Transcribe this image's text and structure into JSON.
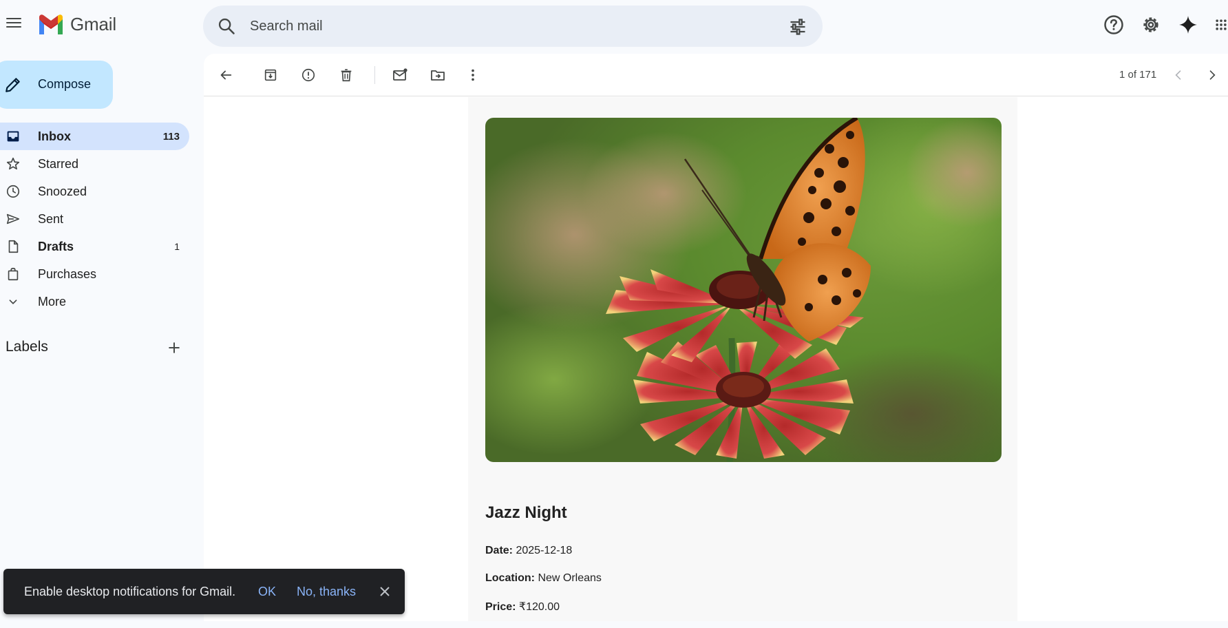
{
  "app": {
    "name": "Gmail"
  },
  "search": {
    "placeholder": "Search mail"
  },
  "sidebar": {
    "compose_label": "Compose",
    "items": [
      {
        "label": "Inbox",
        "count": "113",
        "icon": "inbox-icon",
        "active": true,
        "bold": true
      },
      {
        "label": "Starred",
        "count": "",
        "icon": "star-icon"
      },
      {
        "label": "Snoozed",
        "count": "",
        "icon": "clock-icon"
      },
      {
        "label": "Sent",
        "count": "",
        "icon": "send-icon"
      },
      {
        "label": "Drafts",
        "count": "1",
        "icon": "draft-icon",
        "bold": true
      },
      {
        "label": "Purchases",
        "count": "",
        "icon": "shopping-bag-icon"
      },
      {
        "label": "More",
        "count": "",
        "icon": "chevron-down-icon"
      }
    ],
    "labels_title": "Labels"
  },
  "toolbar": {
    "pager": "1 of 171",
    "icons": [
      "back-arrow-icon",
      "archive-icon",
      "report-spam-icon",
      "delete-icon",
      "mark-unread-icon",
      "move-to-icon",
      "more-vert-icon",
      "prev-page-icon",
      "next-page-icon"
    ]
  },
  "email": {
    "image_alt": "butterfly-on-flower-photo",
    "title": "Jazz Night",
    "date_label": "Date:",
    "date_value": "2025-12-18",
    "location_label": "Location:",
    "location_value": "New Orleans",
    "price_label": "Price:",
    "price_value": "₹120.00"
  },
  "snackbar": {
    "message": "Enable desktop notifications for Gmail.",
    "ok": "OK",
    "no": "No, thanks"
  },
  "colors": {
    "background": "#f8fafd",
    "compose": "#c2e7ff",
    "active_nav": "#d3e3fd",
    "search_bg": "#e9eef6",
    "snackbar": "#202124",
    "snackbar_link": "#8ab4f8"
  }
}
